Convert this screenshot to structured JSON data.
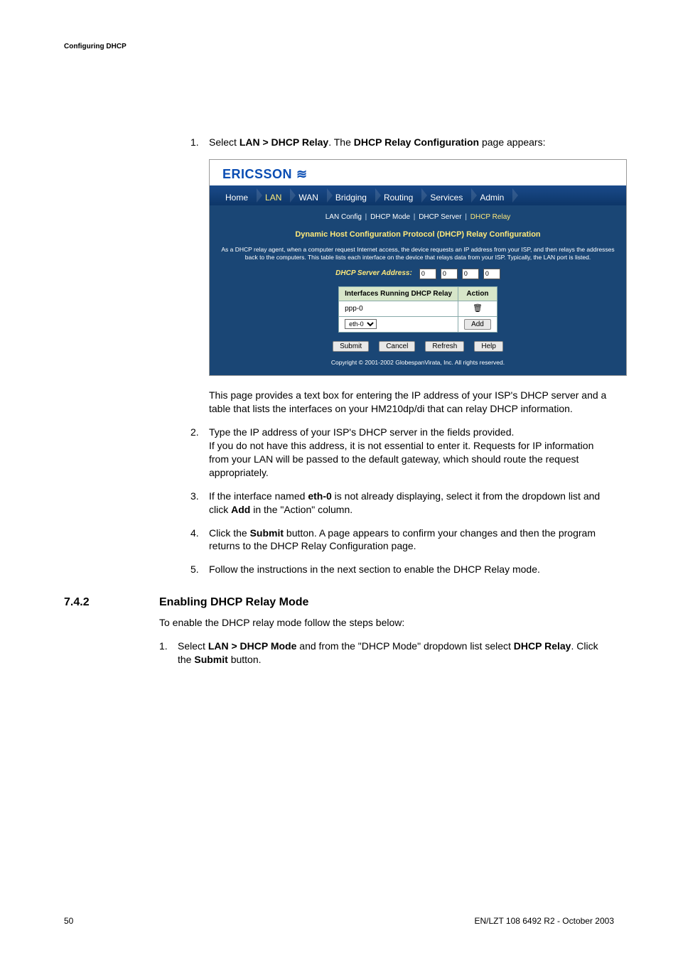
{
  "header": {
    "label": "Configuring DHCP"
  },
  "steps1": [
    {
      "num": "1.",
      "prefix": "Select ",
      "bold1": "LAN > DHCP Relay",
      "mid": ". The ",
      "bold2": "DHCP Relay Configuration",
      "suffix": " page appears:"
    }
  ],
  "screenshot": {
    "logo_text": "ERICSSON",
    "tabs": [
      "Home",
      "LAN",
      "WAN",
      "Bridging",
      "Routing",
      "Services",
      "Admin"
    ],
    "tab_active_index": 1,
    "subnav": [
      "LAN Config",
      "DHCP Mode",
      "DHCP Server",
      "DHCP Relay"
    ],
    "subnav_selected_index": 3,
    "panel_title": "Dynamic Host Configuration Protocol (DHCP) Relay Configuration",
    "desc": "As a DHCP relay agent, when a computer request Internet access, the device requests an IP address from your ISP, and then relays the addresses back to the computers. This table lists each interface on the device that relays data from your ISP. Typically, the LAN port is listed.",
    "addr_label": "DHCP Server Address:",
    "ip": [
      "0",
      "0",
      "0",
      "0"
    ],
    "table": {
      "headers": [
        "Interfaces Running DHCP Relay",
        "Action"
      ],
      "row1_iface": "ppp-0",
      "row2_select": "eth-0",
      "add_label": "Add"
    },
    "buttons": [
      "Submit",
      "Cancel",
      "Refresh",
      "Help"
    ],
    "copyright": "Copyright © 2001-2002 GlobespanVirata, Inc. All rights reserved."
  },
  "para_after_ss": "This page provides a text box for entering the IP address of your ISP's DHCP server and a table that lists the interfaces on your HM210dp/di that can relay DHCP information.",
  "steps2": [
    {
      "num": "2.",
      "lines": [
        "Type the IP address of your ISP's DHCP server in the fields provided.",
        "If you do not have this address, it is not essential to enter it. Requests for IP information from your LAN will be passed to the default gateway, which should route the request appropriately."
      ]
    },
    {
      "num": "3.",
      "pre": "If the interface named ",
      "b1": "eth-0",
      "mid1": " is not already displaying, select it from the dropdown list and click ",
      "b2": "Add",
      "post": " in the \"Action\" column."
    },
    {
      "num": "4.",
      "pre": "Click the ",
      "b1": "Submit",
      "post": " button. A page appears to confirm your changes and then the program returns to the DHCP Relay Configuration page."
    },
    {
      "num": "5.",
      "text": "Follow the instructions in the next section to enable the DHCP Relay mode."
    }
  ],
  "section": {
    "num": "7.4.2",
    "title": "Enabling DHCP Relay Mode",
    "intro": "To enable the DHCP relay mode follow the steps below:",
    "step": {
      "num": "1.",
      "pre": "Select ",
      "b1": "LAN > DHCP Mode",
      "mid1": " and from the \"DHCP Mode\" dropdown list select ",
      "b2": "DHCP Relay",
      "mid2": ". Click the ",
      "b3": "Submit",
      "post": " button."
    }
  },
  "footer": {
    "left": "50",
    "right": "EN/LZT 108 6492 R2  - October 2003"
  }
}
